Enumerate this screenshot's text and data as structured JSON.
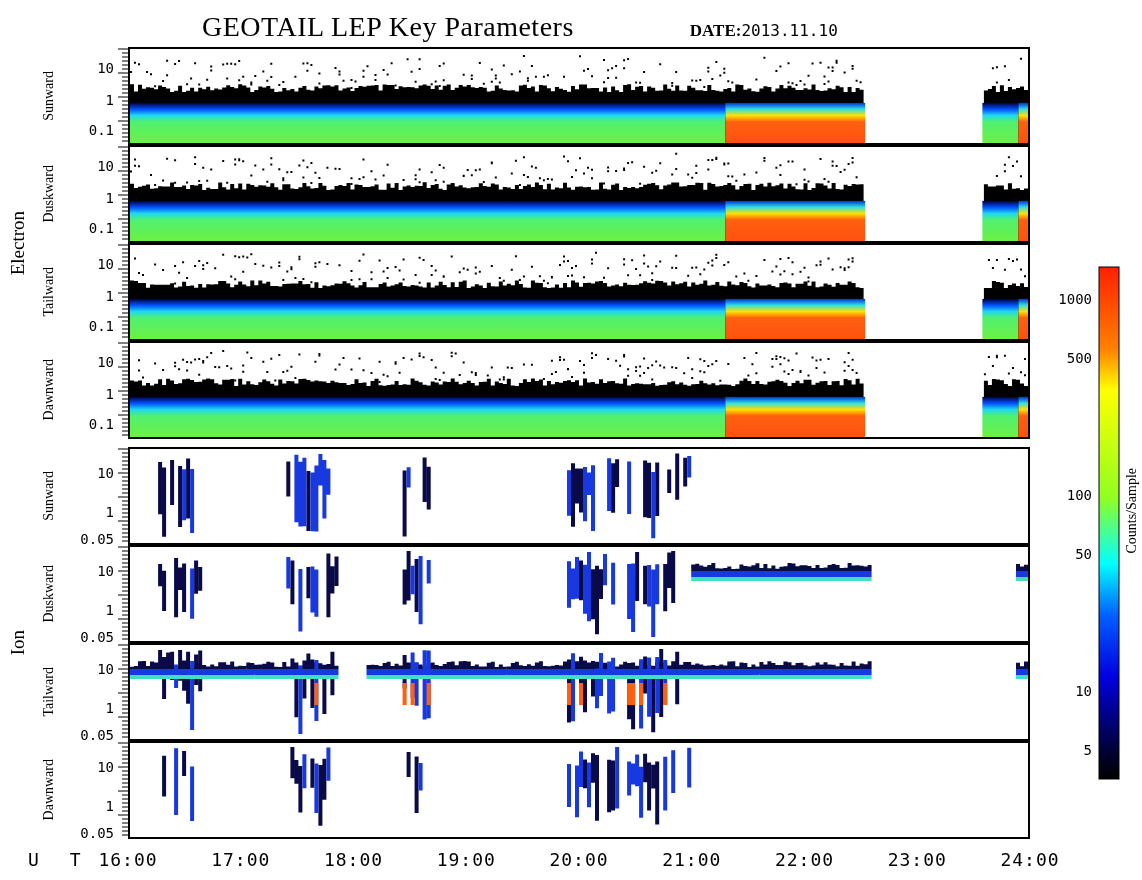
{
  "title": "GEOTAIL LEP Key Parameters",
  "date": {
    "label": "DATE:",
    "value": "2013.11.10"
  },
  "groups": [
    {
      "name": "Electron",
      "kind": "electron",
      "panels": [
        {
          "label": "Sunward",
          "yticks": [
            "10",
            "1",
            "0.1"
          ]
        },
        {
          "label": "Duskward",
          "yticks": [
            "10",
            "1",
            "0.1"
          ]
        },
        {
          "label": "Tailward",
          "yticks": [
            "10",
            "1",
            "0.1"
          ]
        },
        {
          "label": "Dawnward",
          "yticks": [
            "10",
            "1",
            "0.1"
          ]
        }
      ]
    },
    {
      "name": "Ion",
      "kind": "ion",
      "panels": [
        {
          "label": "Sunward",
          "yticks": [
            "10",
            "1",
            "0.05"
          ]
        },
        {
          "label": "Duskward",
          "yticks": [
            "10",
            "1",
            "0.05"
          ]
        },
        {
          "label": "Tailward",
          "yticks": [
            "10",
            "1",
            "0.05"
          ]
        },
        {
          "label": "Dawnward",
          "yticks": [
            "10",
            "1",
            "0.05"
          ]
        }
      ]
    }
  ],
  "x_axis": {
    "label": "U T",
    "ticks": [
      "16:00",
      "17:00",
      "18:00",
      "19:00",
      "20:00",
      "21:00",
      "22:00",
      "23:00",
      "24:00"
    ]
  },
  "colorbar": {
    "title": "Counts/Sample",
    "ticks": [
      "1000",
      "500",
      "100",
      "50",
      "10",
      "5"
    ]
  }
}
